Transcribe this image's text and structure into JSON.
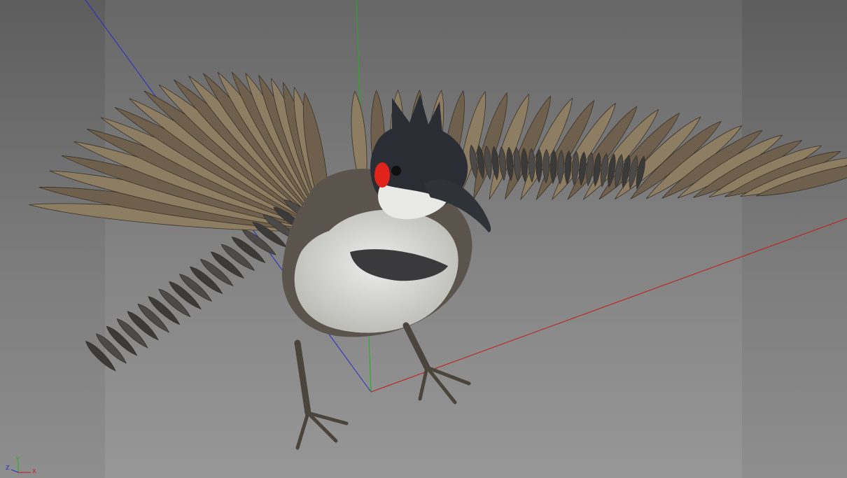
{
  "viewport": {
    "background_top": "#5d5d5d",
    "background_bottom": "#8e8e8e",
    "safe_frame_color": "#757575",
    "axis_colors": {
      "x": "#c41a1a",
      "y": "#1bb21b",
      "z": "#2a2ac8"
    }
  },
  "scene": {
    "subject": "bird-model",
    "colors": {
      "feather_dark": "#4a3f32",
      "feather_mid": "#6e604c",
      "feather_light": "#8d7d63",
      "covert": "#3b3a3a",
      "belly": "#d8d8d4",
      "head": "#2a2d33",
      "cheek_patch": "#e0241c",
      "beak": "#2f3338",
      "leg": "#4b443d"
    }
  },
  "axis_gizmo": {
    "y_label": "Y",
    "x_label": "X",
    "z_label": "Z"
  }
}
